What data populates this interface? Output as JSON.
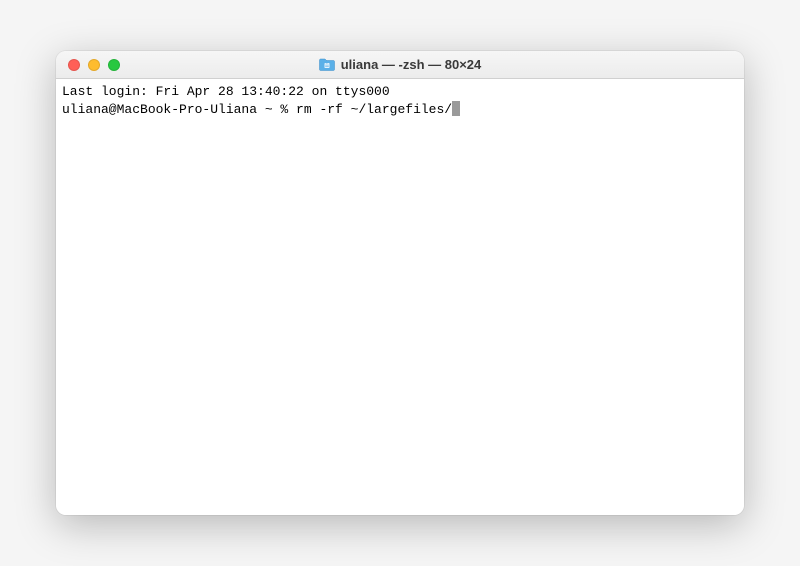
{
  "window": {
    "title": "uliana — -zsh — 80×24"
  },
  "terminal": {
    "last_login_line": "Last login: Fri Apr 28 13:40:22 on ttys000",
    "prompt": "uliana@MacBook-Pro-Uliana ~ % ",
    "command": "rm -rf ~/largefiles/"
  },
  "colors": {
    "close": "#ff5f57",
    "minimize": "#febc2e",
    "maximize": "#28c840"
  }
}
